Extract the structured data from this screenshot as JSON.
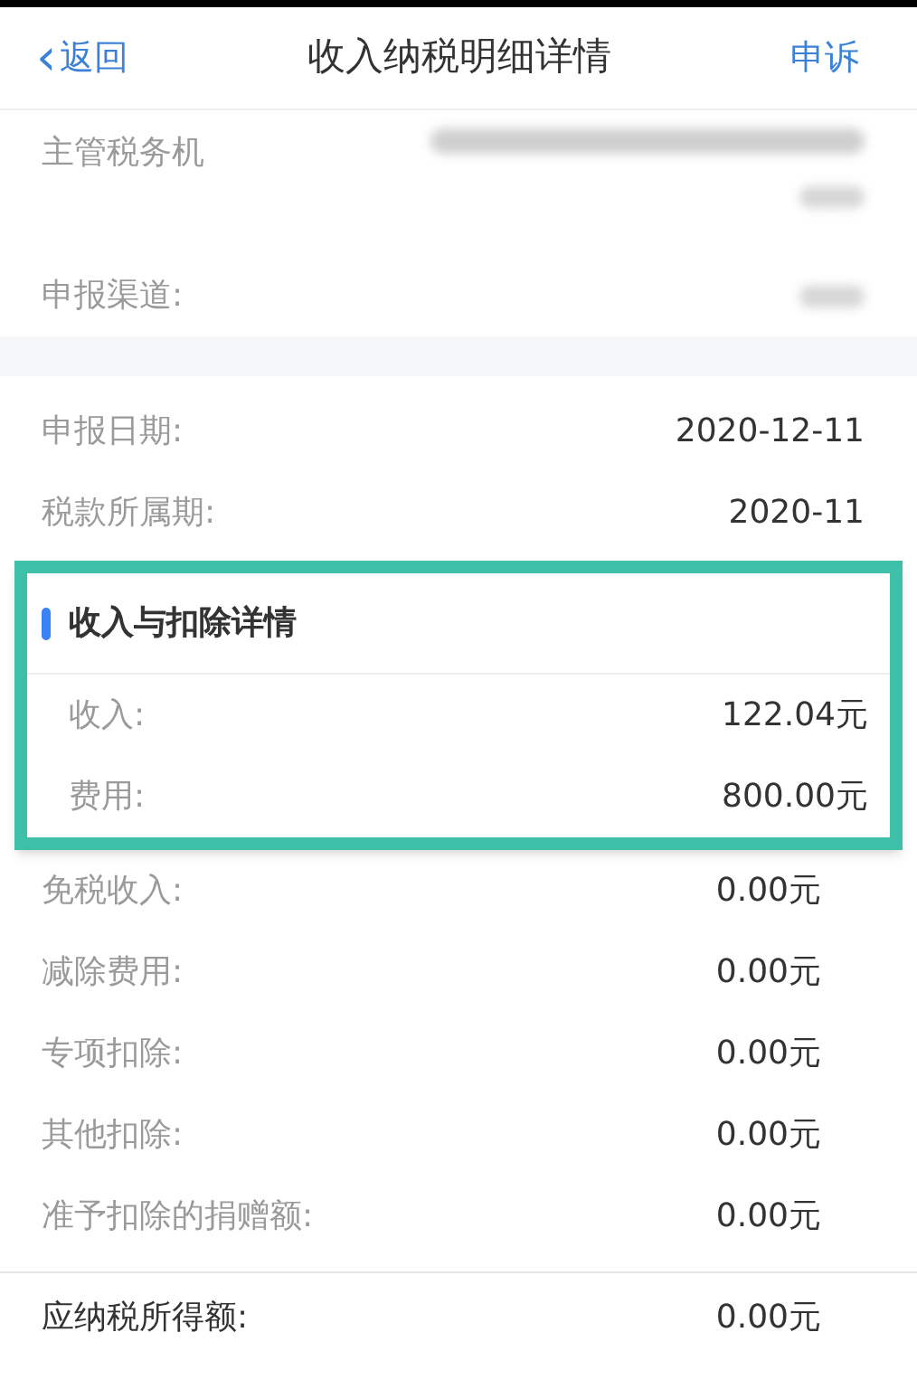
{
  "nav": {
    "back": "返回",
    "back_icon": "‹",
    "title": "收入纳税明细详情",
    "action": "申诉"
  },
  "info_rows": [
    {
      "label": "主管税务机",
      "redacted": true
    },
    {
      "label": "申报渠道:",
      "redacted": true
    }
  ],
  "date_rows": [
    {
      "label": "申报日期:",
      "value": "2020-12-11"
    },
    {
      "label": "税款所属期:",
      "value": "2020-11"
    }
  ],
  "highlight_card": {
    "title": "收入与扣除详情",
    "rows": [
      {
        "label": "收入:",
        "value": "122.04元"
      },
      {
        "label": "费用:",
        "value": "800.00元"
      }
    ]
  },
  "detail_rows": [
    {
      "label": "免税收入:",
      "value": "0.00元"
    },
    {
      "label": "减除费用:",
      "value": "0.00元"
    },
    {
      "label": "专项扣除:",
      "value": "0.00元"
    },
    {
      "label": "其他扣除:",
      "value": "0.00元"
    },
    {
      "label": "准予扣除的捐赠额:",
      "value": "0.00元"
    }
  ],
  "total_row": {
    "label": "应纳税所得额:",
    "value": "0.00元"
  }
}
